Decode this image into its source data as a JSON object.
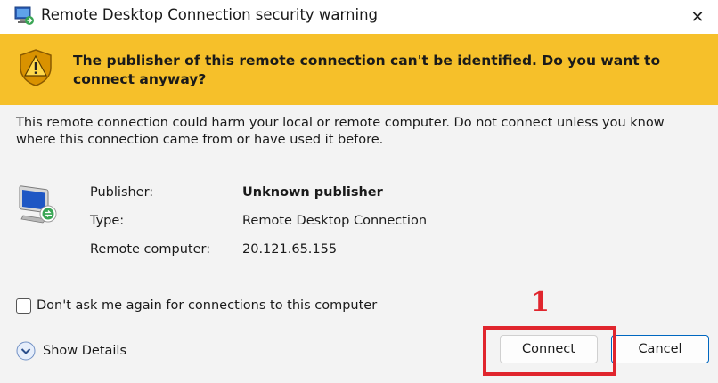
{
  "window": {
    "title": "Remote Desktop Connection security warning",
    "close_glyph": "✕",
    "icon": "remote-desktop-icon"
  },
  "banner": {
    "text": "The publisher of this remote connection can't be identified. Do you want to connect anyway?",
    "icon": "warning-shield-icon",
    "background_color": "#f6c02a"
  },
  "description": "This remote connection could harm your local or remote computer. Do not connect unless you know where this connection came from or have used it before.",
  "details": {
    "icon": "remote-desktop-connection-icon",
    "rows": [
      {
        "label": "Publisher:",
        "value": "Unknown publisher"
      },
      {
        "label": "Type:",
        "value": "Remote Desktop Connection"
      },
      {
        "label": "Remote computer:",
        "value": "20.121.65.155"
      }
    ]
  },
  "checkbox": {
    "label": "Don't ask me again for connections to this computer",
    "checked": false
  },
  "show_details": {
    "label": "Show Details",
    "icon": "chevron-down-circle-icon"
  },
  "buttons": {
    "connect": "Connect",
    "cancel": "Cancel"
  },
  "annotation": {
    "number": "1",
    "color": "#e0252d"
  }
}
